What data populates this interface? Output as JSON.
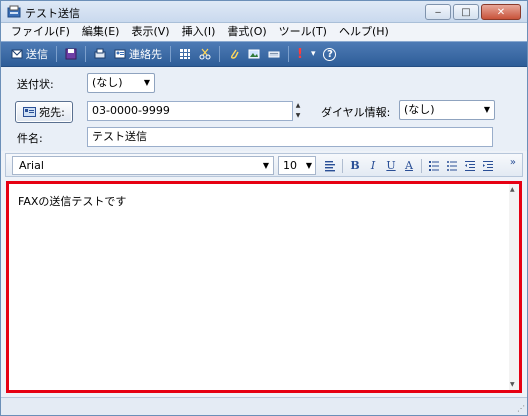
{
  "window": {
    "title": "テスト送信",
    "controls": {
      "minimize": "‒",
      "maximize": "□",
      "close": "✕"
    }
  },
  "menubar": {
    "items": [
      "ファイル(F)",
      "編集(E)",
      "表示(V)",
      "挿入(I)",
      "書式(O)",
      "ツール(T)",
      "ヘルプ(H)"
    ]
  },
  "toolbar": {
    "send_label": "送信",
    "contacts_label": "連絡先",
    "priority_glyph": "!",
    "dropdown_glyph": "▾",
    "help_glyph": "?"
  },
  "header": {
    "cover_label": "送付状:",
    "cover_value": "(なし)",
    "to_button_label": "宛先:",
    "to_value": "03-0000-9999",
    "dial_label": "ダイヤル情報:",
    "dial_value": "(なし)",
    "subject_label": "件名:",
    "subject_value": "テスト送信"
  },
  "format": {
    "font": "Arial",
    "size": "10",
    "bold": "B",
    "italic": "I",
    "underline": "U",
    "color": "A",
    "more": "»"
  },
  "body": {
    "text": "FAXの送信テストです"
  },
  "colors": {
    "highlight": "#e60012",
    "toolbar": "#3a67a4"
  }
}
